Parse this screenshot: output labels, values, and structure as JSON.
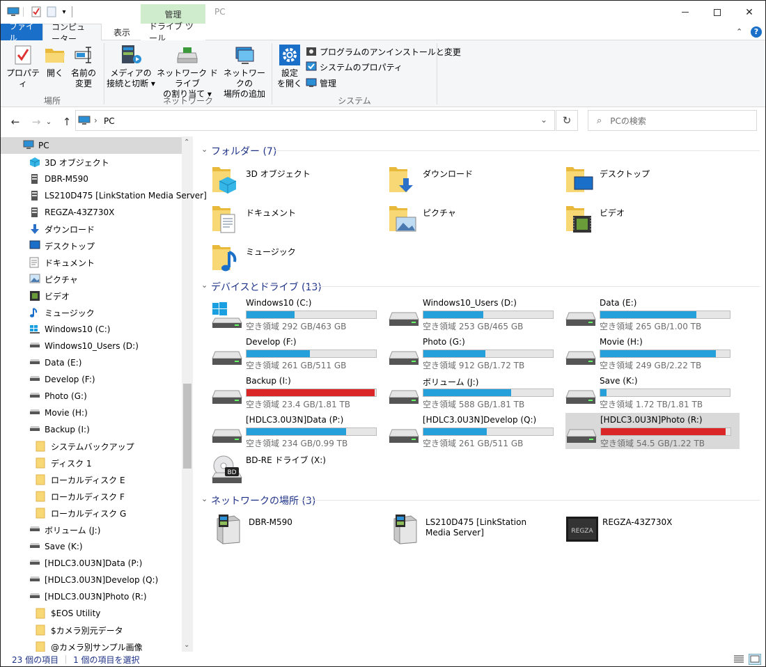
{
  "window": {
    "title": "PC"
  },
  "ribbon": {
    "context_group": "管理",
    "tabs": {
      "file": "ファイル",
      "computer": "コンピューター",
      "view": "表示",
      "drive_tools": "ドライブ ツール"
    },
    "location": {
      "label": "場所",
      "properties": "プロパティ",
      "open": "開く",
      "rename_l1": "名前の",
      "rename_l2": "変更"
    },
    "network": {
      "label": "ネットワーク",
      "media_l1": "メディアの",
      "media_l2": "接続と切断 ▾",
      "map_l1": "ネットワーク ドライブ",
      "map_l2": "の割り当て ▾",
      "add_l1": "ネットワークの",
      "add_l2": "場所の追加"
    },
    "system": {
      "label": "システム",
      "settings_l1": "設定",
      "settings_l2": "を開く",
      "uninstall": "プログラムのアンインストールと変更",
      "sysprops": "システムのプロパティ",
      "manage": "管理"
    }
  },
  "address": {
    "path": "PC",
    "separator": "›"
  },
  "search": {
    "placeholder": "PCの検索"
  },
  "nav": [
    {
      "label": "PC",
      "icon": "pc-icon",
      "indent": 0,
      "selected": true
    },
    {
      "label": "3D オブジェクト",
      "icon": "3d-objects-icon",
      "indent": 1
    },
    {
      "label": "DBR-M590",
      "icon": "media-server-icon",
      "indent": 1
    },
    {
      "label": "LS210D475 [LinkStation Media Server]",
      "icon": "media-server-icon",
      "indent": 1
    },
    {
      "label": "REGZA-43Z730X",
      "icon": "media-server-icon",
      "indent": 1
    },
    {
      "label": "ダウンロード",
      "icon": "download-icon",
      "indent": 1
    },
    {
      "label": "デスクトップ",
      "icon": "desktop-icon",
      "indent": 1
    },
    {
      "label": "ドキュメント",
      "icon": "document-icon",
      "indent": 1
    },
    {
      "label": "ピクチャ",
      "icon": "pictures-icon",
      "indent": 1
    },
    {
      "label": "ビデオ",
      "icon": "video-icon",
      "indent": 1
    },
    {
      "label": "ミュージック",
      "icon": "music-icon",
      "indent": 1
    },
    {
      "label": "Windows10 (C:)",
      "icon": "system-drive-icon",
      "indent": 1
    },
    {
      "label": "Windows10_Users (D:)",
      "icon": "drive-icon",
      "indent": 1
    },
    {
      "label": "Data (E:)",
      "icon": "drive-icon",
      "indent": 1
    },
    {
      "label": "Develop (F:)",
      "icon": "drive-icon",
      "indent": 1
    },
    {
      "label": "Photo (G:)",
      "icon": "drive-icon",
      "indent": 1
    },
    {
      "label": "Movie (H:)",
      "icon": "drive-icon",
      "indent": 1
    },
    {
      "label": "Backup (I:)",
      "icon": "drive-icon",
      "indent": 1
    },
    {
      "label": "システムバックアップ",
      "icon": "folder-icon",
      "indent": 2
    },
    {
      "label": "ディスク 1",
      "icon": "folder-icon",
      "indent": 2
    },
    {
      "label": "ローカルディスク E",
      "icon": "folder-icon",
      "indent": 2
    },
    {
      "label": "ローカルディスク F",
      "icon": "folder-icon",
      "indent": 2
    },
    {
      "label": "ローカルディスク G",
      "icon": "folder-icon",
      "indent": 2
    },
    {
      "label": "ボリューム (J:)",
      "icon": "drive-icon",
      "indent": 1
    },
    {
      "label": "Save (K:)",
      "icon": "drive-icon",
      "indent": 1
    },
    {
      "label": "[HDLC3.0U3N]Data (P:)",
      "icon": "drive-icon",
      "indent": 1
    },
    {
      "label": "[HDLC3.0U3N]Develop (Q:)",
      "icon": "drive-icon",
      "indent": 1
    },
    {
      "label": "[HDLC3.0U3N]Photo (R:)",
      "icon": "drive-icon",
      "indent": 1
    },
    {
      "label": "$EOS Utility",
      "icon": "folder-icon",
      "indent": 2
    },
    {
      "label": "$カメラ別元データ",
      "icon": "folder-icon",
      "indent": 2
    },
    {
      "label": "@カメラ別サンプル画像",
      "icon": "folder-icon",
      "indent": 2
    }
  ],
  "folders": {
    "heading": "フォルダー (7)",
    "items": [
      {
        "label": "3D オブジェクト",
        "icon": "3d-objects-folder-icon"
      },
      {
        "label": "ダウンロード",
        "icon": "downloads-folder-icon"
      },
      {
        "label": "デスクトップ",
        "icon": "desktop-folder-icon"
      },
      {
        "label": "ドキュメント",
        "icon": "documents-folder-icon"
      },
      {
        "label": "ピクチャ",
        "icon": "pictures-folder-icon"
      },
      {
        "label": "ビデオ",
        "icon": "videos-folder-icon"
      },
      {
        "label": "ミュージック",
        "icon": "music-folder-icon"
      }
    ]
  },
  "drives": {
    "heading": "デバイスとドライブ (13)",
    "items": [
      {
        "name": "Windows10 (C:)",
        "free": "空き領域 292 GB/463 GB",
        "used_fraction": 0.37,
        "color": "#26a0da",
        "icon": "windows-drive-icon"
      },
      {
        "name": "Windows10_Users (D:)",
        "free": "空き領域 253 GB/465 GB",
        "used_fraction": 0.46,
        "color": "#26a0da",
        "icon": "hard-drive-icon"
      },
      {
        "name": "Data (E:)",
        "free": "空き領域 265 GB/1.00 TB",
        "used_fraction": 0.74,
        "color": "#26a0da",
        "icon": "hard-drive-icon"
      },
      {
        "name": "Develop (F:)",
        "free": "空き領域 261 GB/511 GB",
        "used_fraction": 0.49,
        "color": "#26a0da",
        "icon": "hard-drive-icon"
      },
      {
        "name": "Photo (G:)",
        "free": "空き領域 912 GB/1.72 TB",
        "used_fraction": 0.48,
        "color": "#26a0da",
        "icon": "hard-drive-icon"
      },
      {
        "name": "Movie (H:)",
        "free": "空き領域 249 GB/2.22 TB",
        "used_fraction": 0.89,
        "color": "#26a0da",
        "icon": "hard-drive-icon"
      },
      {
        "name": "Backup (I:)",
        "free": "空き領域 23.4 GB/1.81 TB",
        "used_fraction": 0.99,
        "color": "#da2626",
        "icon": "hard-drive-icon"
      },
      {
        "name": "ボリューム (J:)",
        "free": "空き領域 588 GB/1.81 TB",
        "used_fraction": 0.68,
        "color": "#26a0da",
        "icon": "hard-drive-icon"
      },
      {
        "name": "Save (K:)",
        "free": "空き領域 1.72 TB/1.81 TB",
        "used_fraction": 0.05,
        "color": "#26a0da",
        "icon": "hard-drive-icon"
      },
      {
        "name": "[HDLC3.0U3N]Data (P:)",
        "free": "空き領域 234 GB/0.99 TB",
        "used_fraction": 0.77,
        "color": "#26a0da",
        "icon": "hard-drive-icon"
      },
      {
        "name": "[HDLC3.0U3N]Develop (Q:)",
        "free": "空き領域 261 GB/511 GB",
        "used_fraction": 0.49,
        "color": "#26a0da",
        "icon": "hard-drive-icon"
      },
      {
        "name": "[HDLC3.0U3N]Photo (R:)",
        "free": "空き領域 54.5 GB/1.22 TB",
        "used_fraction": 0.96,
        "color": "#da2626",
        "icon": "hard-drive-icon",
        "selected": true
      },
      {
        "name": "BD-RE ドライブ (X:)",
        "icon": "bd-drive-icon",
        "icon_badge": "BD"
      }
    ]
  },
  "network": {
    "heading": "ネットワークの場所 (3)",
    "items": [
      {
        "label": "DBR-M590",
        "icon": "media-server-icon"
      },
      {
        "label": "LS210D475 [LinkStation Media Server]",
        "icon": "media-server-icon"
      },
      {
        "label": "REGZA-43Z730X",
        "icon": "regza-tv-icon",
        "icon_text": "REGZA"
      }
    ]
  },
  "status": {
    "count": "23 個の項目",
    "selected": "1 個の項目を選択"
  }
}
